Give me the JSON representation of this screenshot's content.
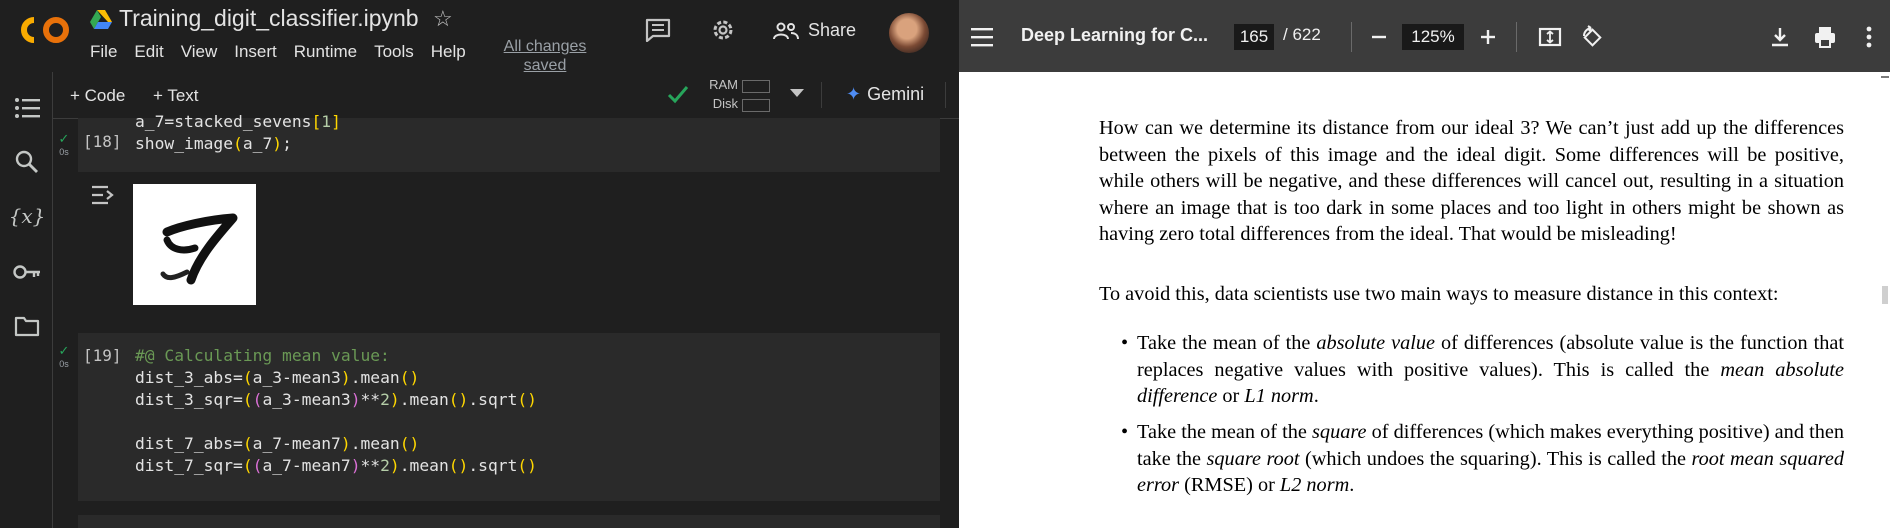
{
  "colab": {
    "logo_text": "CO",
    "filename": "Training_digit_classifier.ipynb",
    "menu": [
      "File",
      "Edit",
      "View",
      "Insert",
      "Runtime",
      "Tools",
      "Help"
    ],
    "saved_status": "All changes saved",
    "share_label": "Share",
    "toolbar": {
      "add_code": "+ Code",
      "add_text": "+ Text",
      "ram_label": "RAM",
      "disk_label": "Disk",
      "gemini_label": "Gemini"
    },
    "sidebar_icons": [
      "table-of-contents-icon",
      "search-icon",
      "variables-icon",
      "key-icon",
      "folder-icon"
    ],
    "cells": [
      {
        "exec_count": "[18]",
        "run_time": "0s",
        "lines": [
          "a_7=stacked_sevens[1]",
          "show_image(a_7);"
        ]
      },
      {
        "exec_count": "[19]",
        "run_time": "0s",
        "lines": [
          "#@ Calculating mean value:",
          "dist_3_abs=(a_3-mean3).mean()",
          "dist_3_sqr=((a_3-mean3)**2).mean().sqrt()",
          "",
          "dist_7_abs=(a_7-mean7).mean()",
          "dist_7_sqr=((a_7-mean7)**2).mean().sqrt()"
        ]
      }
    ],
    "output_image": "handwritten-seven-digit"
  },
  "pdf": {
    "title": "Deep Learning for C...",
    "page_current": "165",
    "page_total": "/ 622",
    "zoom": "125%",
    "para1": "How can we determine its distance from our ideal 3? We can’t just add up the differences between the pixels of this image and the ideal digit. Some differences will be positive, while others will be negative, and these differences will cancel out, resulting in a situation where an image that is too dark in some places and too light in others might be shown as having zero total differences from the ideal. That would be misleading!",
    "para2": "To avoid this, data scientists use two main ways to measure distance in this context:",
    "bullet1": {
      "a": "Take the mean of the ",
      "b": "absolute value",
      "c": " of differences (absolute value is the function that replaces negative values with positive values). This is called the ",
      "d": "mean absolute difference",
      "e": " or ",
      "f": "L1 norm",
      "g": "."
    },
    "bullet2": {
      "a": "Take the mean of the ",
      "b": "square",
      "c": " of differences (which makes everything positive) and then take the ",
      "d": "square root",
      "e": " (which undoes the squaring). This is called the ",
      "f": "root mean squared error",
      "g": " (RMSE) or ",
      "h": "L2 norm",
      "i": "."
    }
  }
}
